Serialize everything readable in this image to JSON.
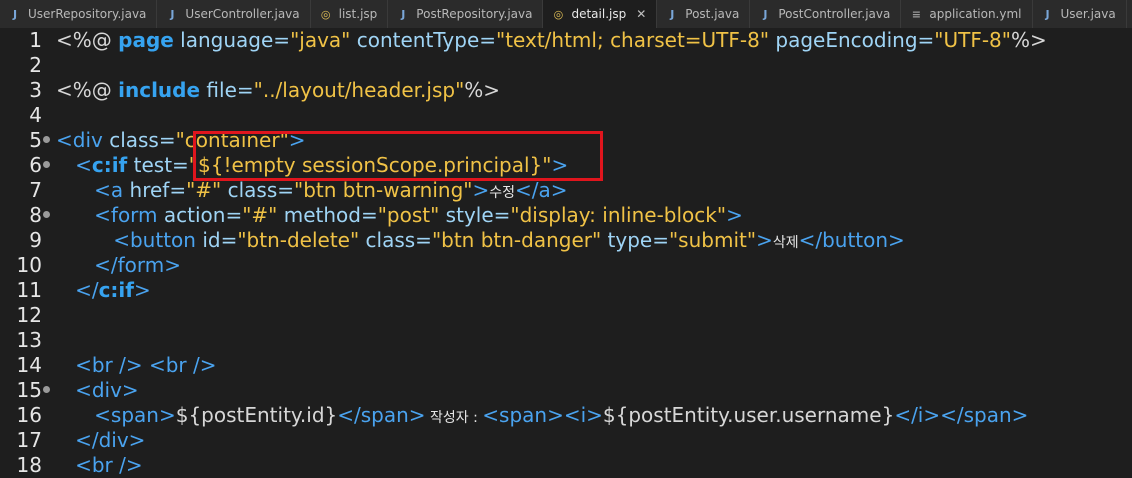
{
  "tabs": [
    {
      "label": "UserRepository.java",
      "icon": "java-file-icon",
      "active": false
    },
    {
      "label": "UserController.java",
      "icon": "java-file-icon",
      "active": false
    },
    {
      "label": "list.jsp",
      "icon": "jsp-file-icon",
      "active": false
    },
    {
      "label": "PostRepository.java",
      "icon": "java-file-icon",
      "active": false
    },
    {
      "label": "detail.jsp",
      "icon": "jsp-file-icon",
      "active": true,
      "close": "✕"
    },
    {
      "label": "Post.java",
      "icon": "java-file-icon",
      "active": false
    },
    {
      "label": "PostController.java",
      "icon": "java-file-icon",
      "active": false
    },
    {
      "label": "application.yml",
      "icon": "yml-file-icon",
      "active": false
    },
    {
      "label": "User.java",
      "icon": "java-file-icon",
      "active": false
    }
  ],
  "line_numbers": [
    "1",
    "2",
    "3",
    "4",
    "5",
    "6",
    "7",
    "8",
    "9",
    "10",
    "11",
    "12",
    "13",
    "14",
    "15",
    "16",
    "17",
    "18"
  ],
  "code": {
    "l1": {
      "a": "<%@ ",
      "b": "page",
      "c": " language=",
      "d": "\"java\"",
      "e": " contentType=",
      "f": "\"text/html; charset=UTF-8\"",
      "g": " pageEncoding=",
      "h": "\"UTF-8\"",
      "i": "%>"
    },
    "l3": {
      "a": "<%@ ",
      "b": "include",
      "c": " file=",
      "d": "\"../layout/header.jsp\"",
      "e": "%>"
    },
    "l5": {
      "a": "<div ",
      "b": "class=",
      "c": "\"container\"",
      "d": ">"
    },
    "l6": {
      "a": "   <",
      "b": "c:if",
      "c": " test=",
      "d": "\"${!empty sessionScope.principal}\"",
      "e": ">"
    },
    "l7": {
      "a": "      <a ",
      "b": "href=",
      "c": "\"#\"",
      "d": " class=",
      "e": "\"btn btn-warning\"",
      "f": ">",
      "g": "수정",
      "h": "</a>"
    },
    "l8": {
      "a": "      <form ",
      "b": "action=",
      "c": "\"#\"",
      "d": " method=",
      "e": "\"post\"",
      "f": " style=",
      "g": "\"display: inline-block\"",
      "h": ">"
    },
    "l9": {
      "a": "         <button ",
      "b": "id=",
      "c": "\"btn-delete\"",
      "d": " class=",
      "e": "\"btn btn-danger\"",
      "f": " type=",
      "g": "\"submit\"",
      "h": ">",
      "i": "삭제",
      "j": "</button>"
    },
    "l10": {
      "a": "      </form>"
    },
    "l11": {
      "a": "   </",
      "b": "c:if",
      "c": ">"
    },
    "l14": {
      "a": "   <br /> <br />"
    },
    "l15": {
      "a": "   <div>"
    },
    "l16": {
      "a": "      <span>",
      "b": "${postEntity.id}",
      "c": "</span>",
      "d": " 작성자 : ",
      "e": "<span><i>",
      "f": "${postEntity.user.username}",
      "g": "</i></span>"
    },
    "l17": {
      "a": "   </div>"
    },
    "l18": {
      "a": "   <br />"
    }
  },
  "colors": {
    "background": "#1e1e1e",
    "highlight": "#e0151d",
    "string": "#f0c246",
    "keyword": "#36a3f0",
    "attribute": "#9fd4f5"
  }
}
